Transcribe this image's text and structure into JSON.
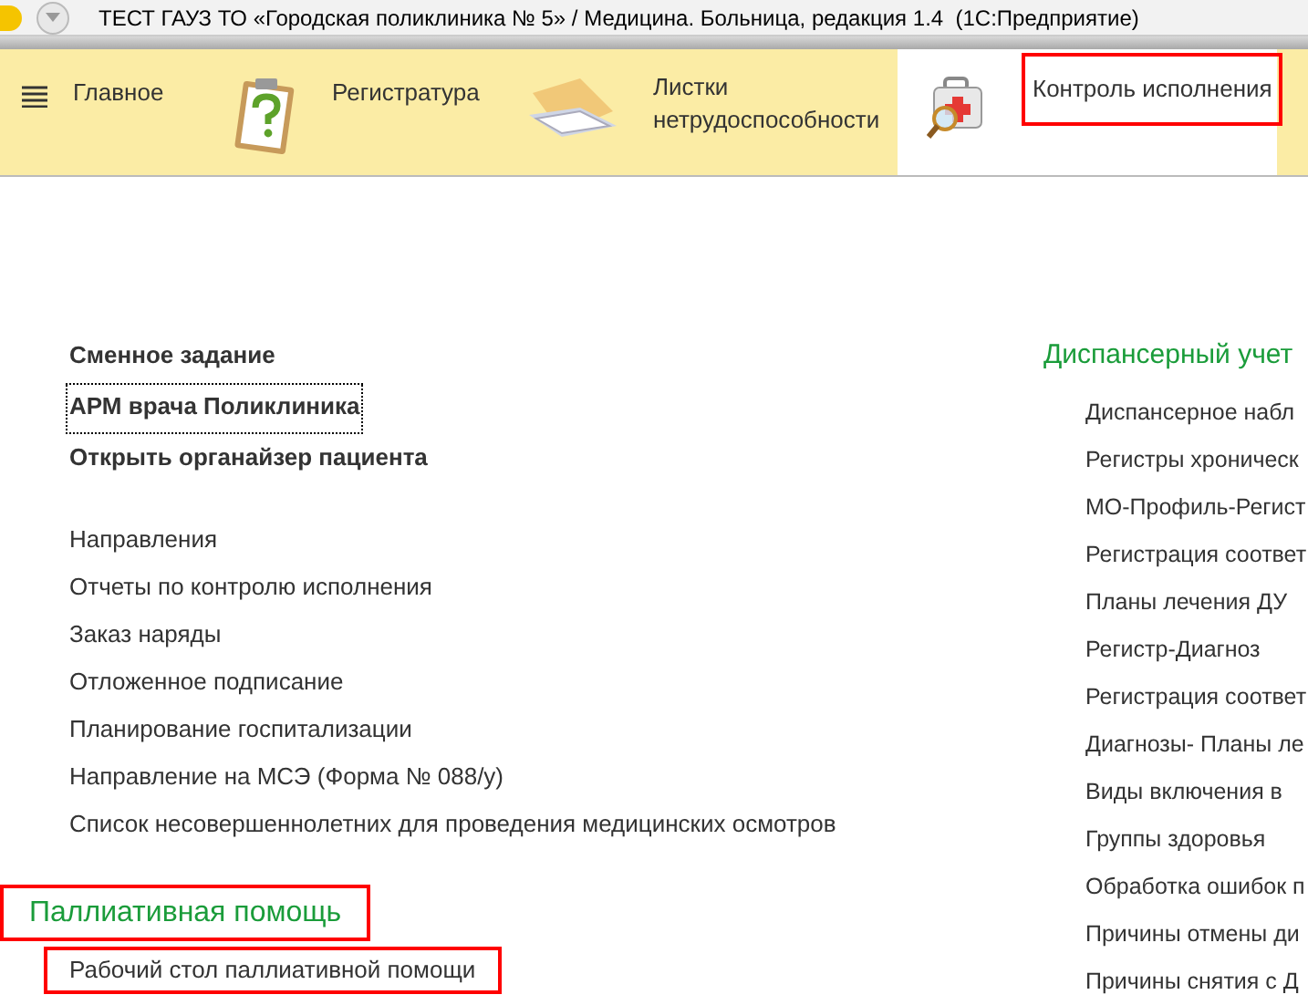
{
  "window": {
    "title": "ТЕСТ ГАУЗ ТО «Городская поликлиника № 5» / Медицина. Больница, редакция 1.4  (1С:Предприятие)"
  },
  "sections": [
    {
      "kind": "menu",
      "label": "Главное",
      "selected": false,
      "highlighted": false
    },
    {
      "kind": "clipboard",
      "label": "Регистратура",
      "selected": false,
      "highlighted": false
    },
    {
      "kind": "folder",
      "label": "Листки нетрудоспособности",
      "selected": false,
      "highlighted": false
    },
    {
      "kind": "kit",
      "label": "Контроль исполнения",
      "selected": true,
      "highlighted": true
    }
  ],
  "left_groups": [
    {
      "items": [
        {
          "label": "Сменное задание",
          "bold": true,
          "focused": false,
          "highlighted": false
        },
        {
          "label": "АРМ врача Поликлиника",
          "bold": true,
          "focused": true,
          "highlighted": false
        },
        {
          "label": "Открыть органайзер пациента",
          "bold": true,
          "focused": false,
          "highlighted": false
        }
      ]
    },
    {
      "items": [
        {
          "label": "Направления",
          "bold": false,
          "focused": false,
          "highlighted": false
        },
        {
          "label": "Отчеты по контролю исполнения",
          "bold": false,
          "focused": false,
          "highlighted": false
        },
        {
          "label": "Заказ наряды",
          "bold": false,
          "focused": false,
          "highlighted": false
        },
        {
          "label": "Отложенное подписание",
          "bold": false,
          "focused": false,
          "highlighted": false
        },
        {
          "label": "Планирование госпитализации",
          "bold": false,
          "focused": false,
          "highlighted": false
        },
        {
          "label": "Направление на МСЭ (Форма № 088/у)",
          "bold": false,
          "focused": false,
          "highlighted": false
        },
        {
          "label": "Список несовершеннолетних для проведения медицинских осмотров",
          "bold": false,
          "focused": false,
          "highlighted": false
        }
      ]
    },
    {
      "heading": "Паллиативная помощь",
      "heading_highlighted": true,
      "items": [
        {
          "label": "Рабочий стол паллиативной помощи",
          "bold": false,
          "focused": false,
          "highlighted": true
        }
      ]
    }
  ],
  "right_group": {
    "heading": "Диспансерный учет",
    "items": [
      "Диспансерное набл",
      "Регистры хроническ",
      "МО-Профиль-Регист",
      "Регистрация соответ",
      "Планы лечения ДУ",
      "Регистр-Диагноз",
      "Регистрация соответ",
      "Диагнозы- Планы ле",
      "Виды включения в",
      "Группы здоровья",
      "Обработка ошибок п",
      "Причины отмены ди",
      "Причины снятия с Д"
    ]
  }
}
